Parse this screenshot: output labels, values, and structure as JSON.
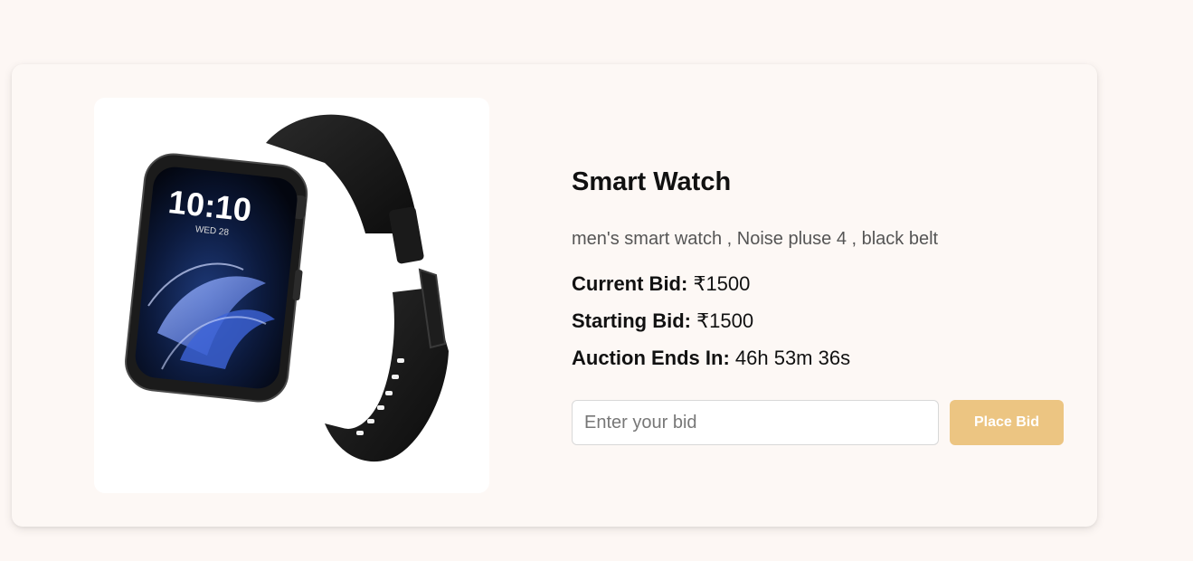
{
  "product": {
    "title": "Smart Watch",
    "description": "men's smart watch , Noise pluse 4 , black belt",
    "image_alt": "smart-watch-photo",
    "watch_face": {
      "time": "10:10",
      "date": "WED 28"
    }
  },
  "bids": {
    "current_label": "Current Bid:",
    "current_value": "₹1500",
    "starting_label": "Starting Bid:",
    "starting_value": "₹1500",
    "ends_label": "Auction Ends In:",
    "ends_value": "46h 53m 36s"
  },
  "bid_form": {
    "input_placeholder": "Enter your bid",
    "input_value": "",
    "button_label": "Place Bid"
  },
  "colors": {
    "page_background": "#fdf7f4",
    "card_background": "#fdf8f5",
    "button_accent": "#ecc582"
  }
}
